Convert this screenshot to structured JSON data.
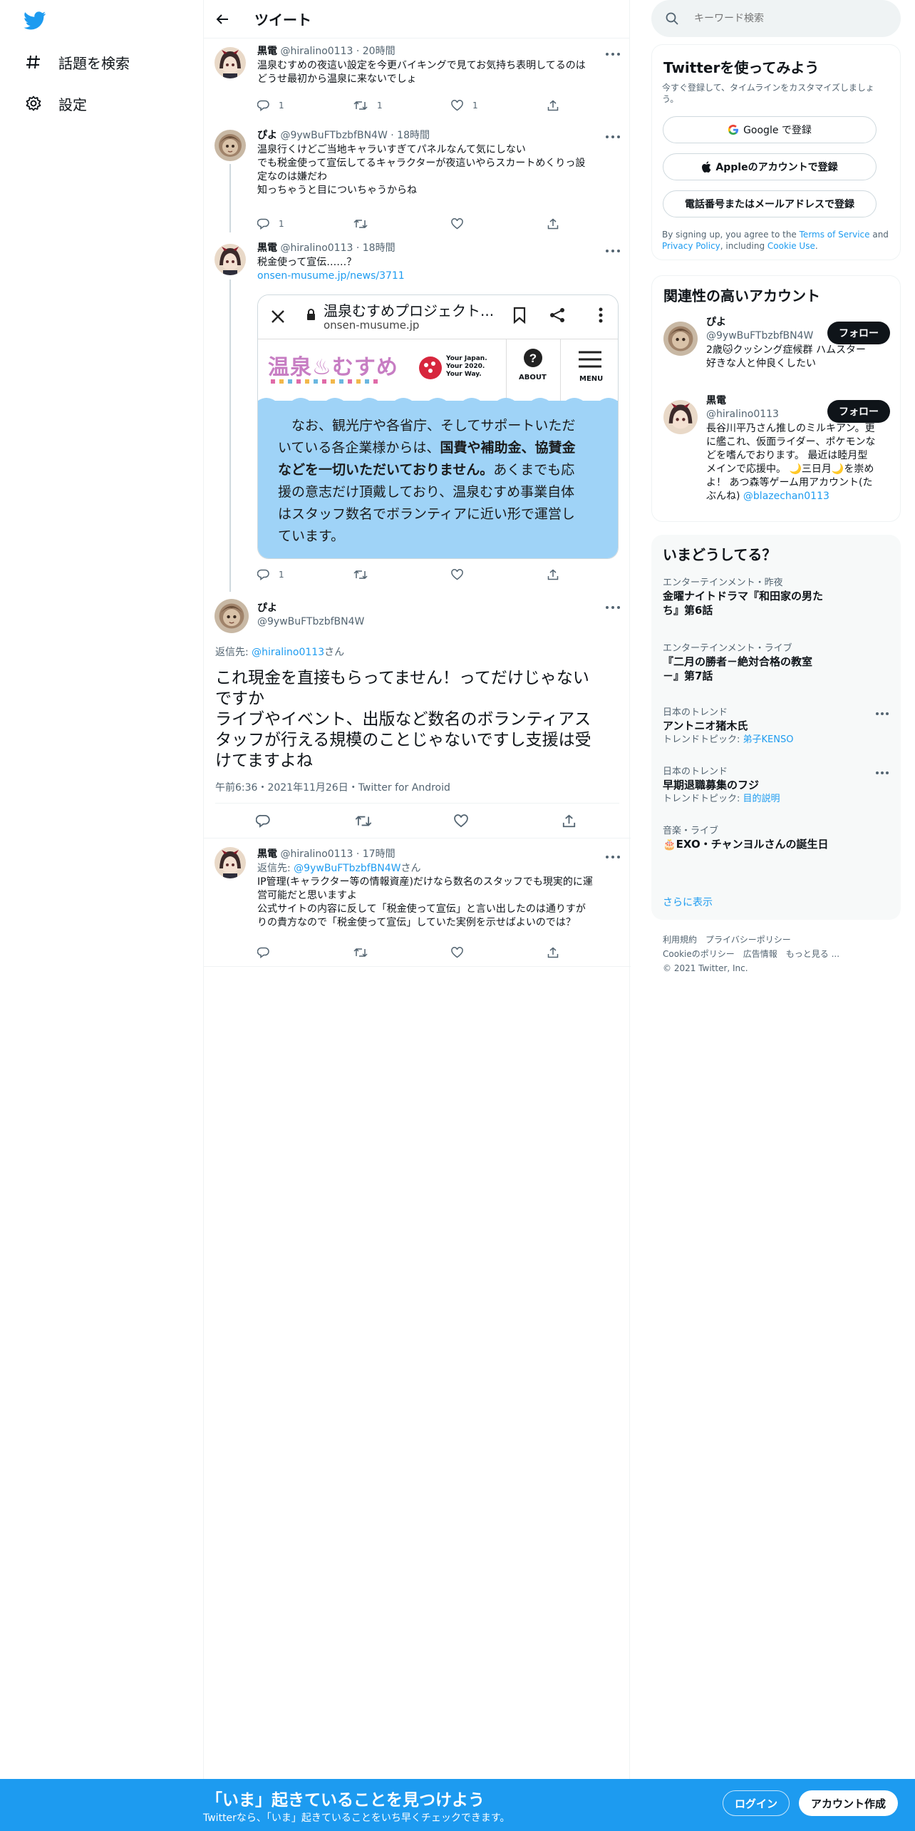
{
  "nav": {
    "explore_label": "話題を検索",
    "settings_label": "設定"
  },
  "header": {
    "title": "ツイート"
  },
  "tweets": [
    {
      "name": "黒電",
      "handle": "@hiralino0113",
      "time": "20時間",
      "text": "温泉むすめの夜這い設定を今更バイキングで見てお気持ち表明してるのは\nどうせ最初から温泉に来ないでしょ",
      "replies": "1",
      "retweets": "1",
      "likes": "1"
    },
    {
      "name": "ぴよ",
      "handle": "@9ywBuFTbzbfBN4W",
      "time": "18時間",
      "text": "温泉行くけどご当地キャラいすぎてパネルなんて気にしない\nでも税金使って宣伝してるキャラクターが夜這いやらスカートめくりっ設\n定なのは嫌だわ\n知っちゃうと目についちゃうからね",
      "replies": "1"
    },
    {
      "name": "黒電",
      "handle": "@hiralino0113",
      "time": "18時間",
      "text": "税金使って宣伝……？",
      "link": "onsen-musume.jp/news/3711",
      "replies": "1"
    }
  ],
  "card": {
    "browser_title": "温泉むすめプロジェクト...",
    "browser_url": "onsen-musume.jp",
    "logo_text": "温泉♨むすめ",
    "seal_text": "Your Japan.\nYour 2020.\nYour Way.",
    "about_label": "ABOUT",
    "menu_label": "MENU",
    "p1": "　なお、観光庁や各省庁、そしてサポートいただ\nいている各企業様からは、",
    "p1_bold": "国費や補助金、協賛金\nなどを一切いただいておりません。",
    "p2": "あくまでも応\n援の意志だけ頂戴しており、温泉むすめ事業自体\nはスタッフ数名でボランティアに近い形で運営し\nています。"
  },
  "main_tweet": {
    "name": "ぴよ",
    "handle": "@9ywBuFTbzbfBN4W",
    "reply_prefix": "返信先: ",
    "reply_to": "@hiralino0113",
    "reply_suffix": "さん",
    "text": "これ現金を直接もらってません！ってだけじゃない\nですか\nライブやイベント、出版など数名のボランティアス\nタッフが行える規模のことじゃないですし支援は受\nけてますよね",
    "meta": "午前6:36・2021年11月26日・Twitter for Android"
  },
  "reply_tweet": {
    "name": "黒電",
    "handle": "@hiralino0113",
    "time": "17時間",
    "reply_prefix": "返信先: ",
    "reply_to": "@9ywBuFTbzbfBN4W",
    "reply_suffix": "さん",
    "text": "IP管理(キャラクター等の情報資産)だけなら数名のスタッフでも現実的に運\n営可能だと思いますよ\n公式サイトの内容に反して「税金使って宣伝」と言い出したのは通りすが\nりの貴方なので「税金使って宣伝」していた実例を示せばよいのでは？"
  },
  "search": {
    "placeholder": "キーワード検索"
  },
  "signup_panel": {
    "title": "Twitterを使ってみよう",
    "desc": "今すぐ登録して、タイムラインをカスタマイズしましょう。",
    "google": "Google で登録",
    "apple": "Appleのアカウントで登録",
    "phone": "電話番号またはメールアドレスで登録",
    "terms_pre": "By signing up, you agree to the ",
    "terms_tos": "Terms of Service",
    "terms_and": " and ",
    "terms_privacy": "Privacy Policy",
    "terms_inc": ", including ",
    "terms_cookie": "Cookie Use",
    "terms_end": "."
  },
  "related": {
    "title": "関連性の高いアカウント",
    "follow_label": "フォロー",
    "accounts": [
      {
        "name": "ぴよ",
        "handle": "@9ywBuFTbzbfBN4W",
        "bio": "2歳🐱クッシング症候群 ハムスター\n好きな人と仲良くしたい"
      },
      {
        "name": "黒電",
        "handle": "@hiralino0113",
        "bio": "長谷川平乃さん推しのミルキアン。更\nに艦これ、仮面ライダー、ポケモンな\nどを嗜んでおります。 最近は睦月型\nメインで応援中。 🌙三日月🌙を崇め\nよ！ あつ森等ゲーム用アカウント(た\nぶんね) ",
        "bio_link": "@blazechan0113"
      }
    ]
  },
  "trends": {
    "title": "いまどうしてる？",
    "items": [
      {
        "context": "エンターテインメント・昨夜",
        "title": "金曜ナイトドラマ『和田家の男た\nち』第6話"
      },
      {
        "context": "エンターテインメント・ライブ",
        "title": "『二月の勝者－絶対合格の教室\n－』第7話"
      },
      {
        "context": "日本のトレンド",
        "title": "アントニオ猪木氏",
        "topic_prefix": "トレンドトピック: ",
        "topic": "弟子KENSO"
      },
      {
        "context": "日本のトレンド",
        "title": "早期退職募集のフジ",
        "topic_prefix": "トレンドトピック: ",
        "topic": "目的説明"
      },
      {
        "context": "音楽・ライブ",
        "title": "🎂EXO・チャンヨルさんの誕生日"
      }
    ],
    "show_more": "さらに表示"
  },
  "footer": {
    "terms": "利用規約",
    "privacy": "プライバシーポリシー",
    "cookie": "Cookieのポリシー",
    "ads": "広告情報",
    "more": "もっと見る ...",
    "copyright": "© 2021 Twitter, Inc."
  },
  "bottom_bar": {
    "headline": "「いま」起きていることを見つけよう",
    "sub": "Twitterなら、「いま」起きていることをいち早くチェックできます。",
    "login": "ログイン",
    "signup": "アカウント作成"
  },
  "colors": {
    "accent": "#1d9bf0",
    "text": "#0f1419",
    "muted": "#536471",
    "card_bg": "#9fd3f7"
  }
}
